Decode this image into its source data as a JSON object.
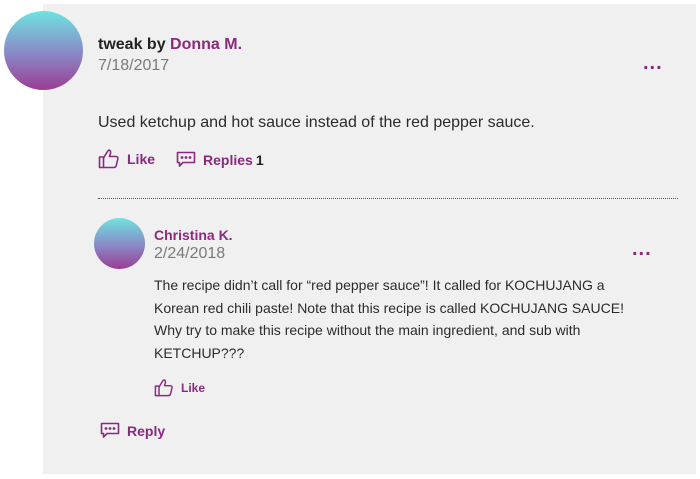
{
  "comment": {
    "tag": "tweak by",
    "author": "Donna M.",
    "date": "7/18/2017",
    "text": "Used ketchup and hot sauce instead of the red pepper sauce.",
    "like_label": "Like",
    "replies_label": "Replies",
    "replies_count": "1",
    "more_label": "..."
  },
  "reply": {
    "author": "Christina K.",
    "date": "2/24/2018",
    "lines": [
      "The recipe didn’t call for “red pepper sauce”! It called for KOCHUJANG a",
      "Korean red chili paste! Note that this recipe is called KOCHUJANG SAUCE!",
      "Why try to make this recipe without the main ingredient, and sub with",
      "KETCHUP???"
    ],
    "like_label": "Like",
    "more_label": "..."
  },
  "reply_action": {
    "label": "Reply"
  },
  "icons": {
    "like": "thumbs-up-icon",
    "comment": "comment-icon",
    "more": "more-options-icon"
  },
  "colors": {
    "accent": "#8a2a7e",
    "card_bg": "#f0f0f0"
  }
}
